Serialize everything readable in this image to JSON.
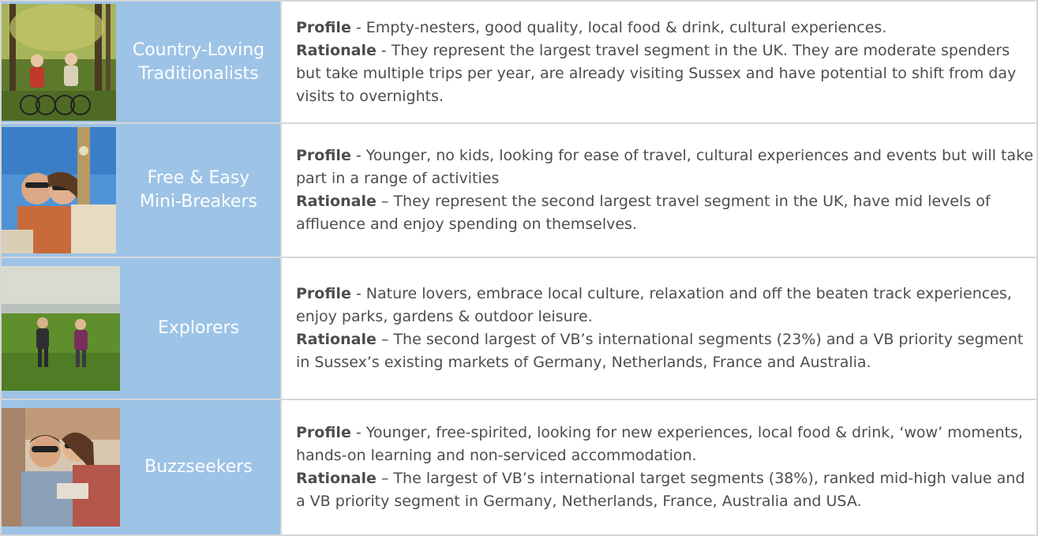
{
  "segments": [
    {
      "name_line1": "Country-Loving",
      "name_line2": "Traditionalists",
      "photo_icon": "cyclists-photo",
      "profile_label": "Profile",
      "profile_text": " - Empty-nesters, good quality, local food & drink, cultural experiences.",
      "rationale_label": "Rationale",
      "rationale_text": " - They represent the largest travel segment in the UK. They are moderate spenders but take multiple trips per year, are already visiting Sussex and have potential to shift from day visits to overnights."
    },
    {
      "name_line1": "Free & Easy",
      "name_line2": "Mini-Breakers",
      "photo_icon": "couple-selfie-big-ben-photo",
      "profile_label": "Profile",
      "profile_text": " - Younger, no kids, looking for ease of travel, cultural experiences and events but will take part in a range of activities",
      "rationale_label": "Rationale",
      "rationale_text": " – They represent the second largest travel segment in the UK, have mid levels of affluence and enjoy spending on themselves."
    },
    {
      "name_line1": "Explorers",
      "name_line2": "",
      "photo_icon": "couple-walking-field-photo",
      "profile_label": "Profile",
      "profile_text": " - Nature lovers, embrace local culture, relaxation and off the beaten track experiences, enjoy parks, gardens & outdoor leisure.",
      "rationale_label": "Rationale",
      "rationale_text": " – The second largest of VB’s international segments (23%) and a VB priority segment in Sussex’s existing markets of Germany, Netherlands, France and Australia."
    },
    {
      "name_line1": "Buzzseekers",
      "name_line2": "",
      "photo_icon": "couple-piggyback-photo",
      "profile_label": "Profile",
      "profile_text": " - Younger, free-spirited, looking for new experiences, local food & drink, ‘wow’ moments, hands-on learning and non-serviced accommodation.",
      "rationale_label": "Rationale",
      "rationale_text": " – The largest of VB’s international target segments (38%), ranked mid-high value and a VB priority segment in Germany, Netherlands, France, Australia and USA."
    }
  ],
  "colors": {
    "left_cell_bg": "#9dc3e6",
    "left_cell_text": "#ffffff",
    "body_text": "#4d4d4d",
    "border": "#d6d6d6"
  }
}
